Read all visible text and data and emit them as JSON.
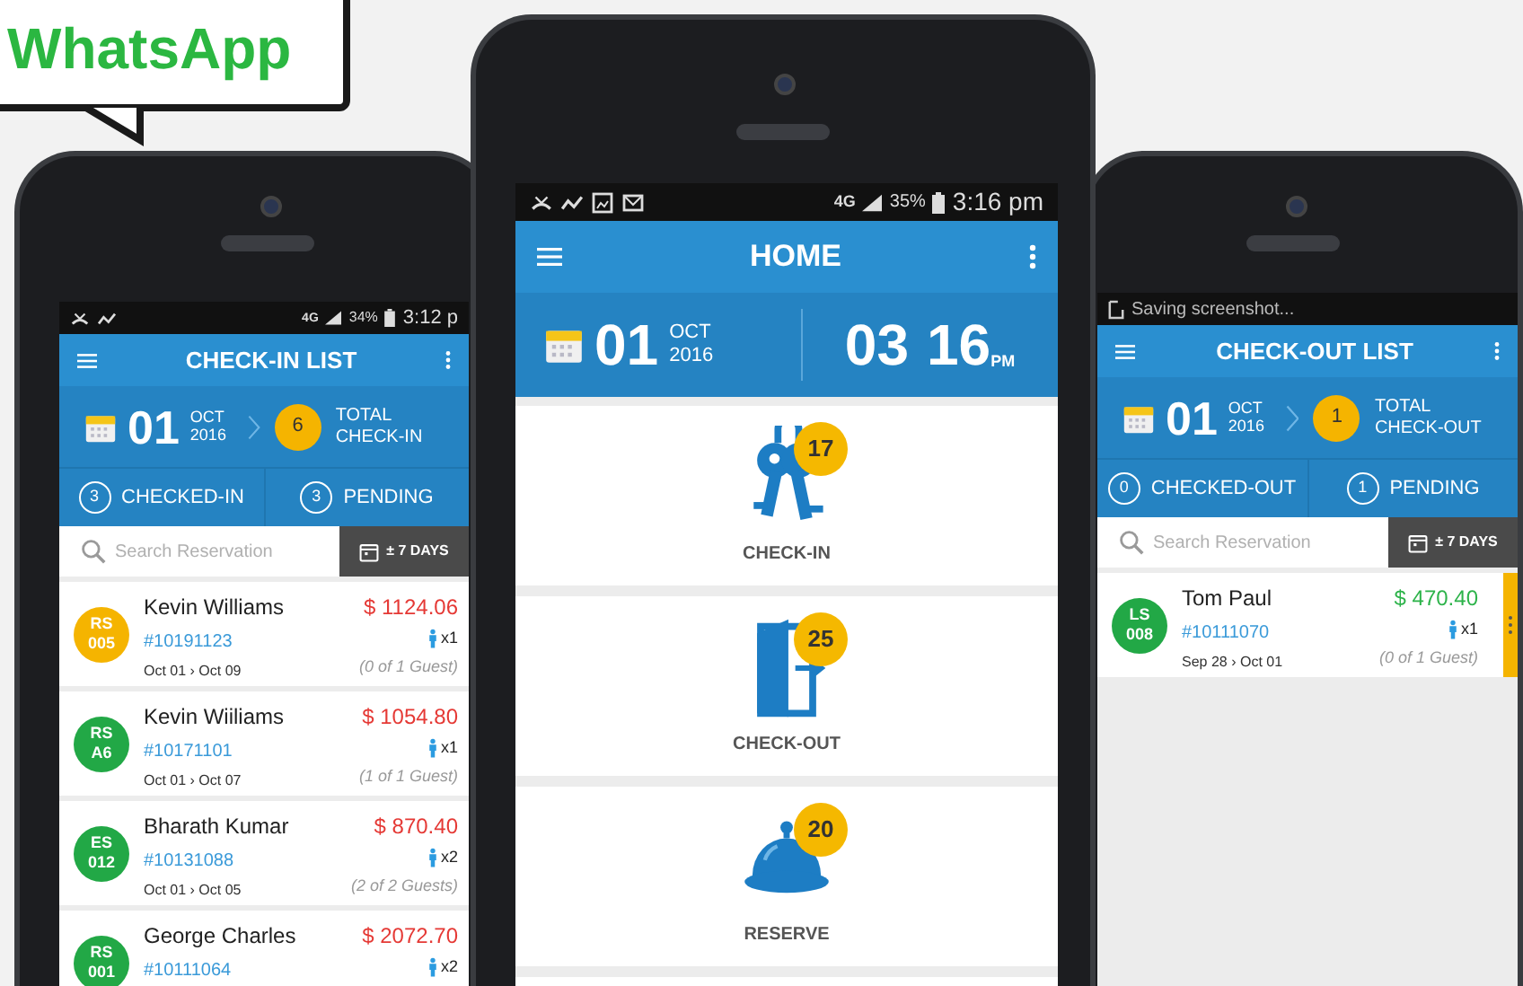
{
  "banner": {
    "text": "WhatsApp"
  },
  "phones": [
    {
      "kind": "list",
      "status": {
        "network": "4G",
        "battery": "34%",
        "time": "3:12 p"
      },
      "title": "CHECK-IN LIST",
      "date": {
        "day": "01",
        "month": "OCT",
        "year": "2016"
      },
      "total": {
        "count": "6",
        "label": "TOTAL CHECK-IN"
      },
      "tabs": [
        {
          "count": "3",
          "label": "CHECKED-IN"
        },
        {
          "count": "3",
          "label": "PENDING"
        }
      ],
      "search": {
        "placeholder": "Search Reservation"
      },
      "range_button": "± 7 DAYS",
      "reservations": [
        {
          "code": "RS 005",
          "color": "#f5b400",
          "name": "Kevin Williams",
          "amount": {
            "text": "$ 1124.06",
            "color": "#e53935"
          },
          "number": "#10191123",
          "guests": "x1",
          "dates": "Oct 01 › Oct 09",
          "guest_status": "(0 of 1 Guest)"
        },
        {
          "code": "RS A6",
          "color": "#22a846",
          "name": "Kevin Wiiliams",
          "amount": {
            "text": "$ 1054.80",
            "color": "#e53935"
          },
          "number": "#10171101",
          "guests": "x1",
          "dates": "Oct 01 › Oct 07",
          "guest_status": "(1 of 1 Guest)"
        },
        {
          "code": "ES 012",
          "color": "#22a846",
          "name": "Bharath Kumar",
          "amount": {
            "text": "$ 870.40",
            "color": "#e53935"
          },
          "number": "#10131088",
          "guests": "x2",
          "dates": "Oct 01 › Oct 05",
          "guest_status": "(2 of 2 Guests)"
        },
        {
          "code": "RS 001",
          "color": "#22a846",
          "name": "George Charles",
          "amount": {
            "text": "$ 2072.70",
            "color": "#e53935"
          },
          "number": "#10111064",
          "guests": "x2"
        }
      ]
    },
    {
      "kind": "home",
      "status": {
        "network": "4G",
        "battery": "35%",
        "time": "3:16 pm"
      },
      "title": "HOME",
      "date": {
        "day": "01",
        "month": "OCT",
        "year": "2016"
      },
      "clock": {
        "hours": "03",
        "minutes": "16",
        "period": "PM"
      },
      "tiles": [
        {
          "kind": "keys",
          "label": "CHECK-IN",
          "count": "17"
        },
        {
          "kind": "door",
          "label": "CHECK-OUT",
          "count": "25"
        },
        {
          "kind": "bell",
          "label": "RESERVE",
          "count": "20"
        }
      ]
    },
    {
      "kind": "list",
      "status": {
        "notification": "Saving screenshot..."
      },
      "title": "CHECK-OUT LIST",
      "date": {
        "day": "01",
        "month": "OCT",
        "year": "2016"
      },
      "total": {
        "count": "1",
        "label": "TOTAL CHECK-OUT"
      },
      "tabs": [
        {
          "count": "0",
          "label": "CHECKED-OUT"
        },
        {
          "count": "1",
          "label": "PENDING"
        }
      ],
      "search": {
        "placeholder": "Search Reservation"
      },
      "range_button": "± 7 DAYS",
      "reservations": [
        {
          "code": "LS 008",
          "color": "#22a846",
          "name": "Tom Paul",
          "amount": {
            "text": "$ 470.40",
            "color": "#2db34a"
          },
          "number": "#10111070",
          "guests": "x1",
          "dates": "Sep 28 › Oct 01",
          "guest_status": "(0 of 1 Guest)",
          "handle": {
            "color": "#f5b400"
          }
        }
      ]
    }
  ]
}
